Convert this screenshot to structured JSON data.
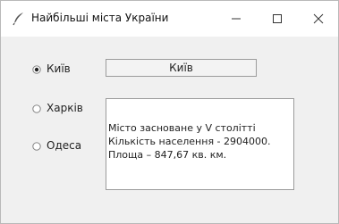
{
  "window": {
    "title": "Найбільші міста України",
    "app_icon": "feather-icon",
    "controls": {
      "minimize_icon": "minimize-icon",
      "maximize_icon": "maximize-icon",
      "close_icon": "close-icon"
    }
  },
  "cities": {
    "options": [
      {
        "label": "Київ",
        "selected": true
      },
      {
        "label": "Харків",
        "selected": false
      },
      {
        "label": "Одеса",
        "selected": false
      }
    ]
  },
  "selected_city": {
    "value": "Київ"
  },
  "info": {
    "lines": [
      "Місто засноване у V столітті",
      "Кількість населення - 2904000.",
      "Площа – 847,67 кв. км."
    ]
  }
}
